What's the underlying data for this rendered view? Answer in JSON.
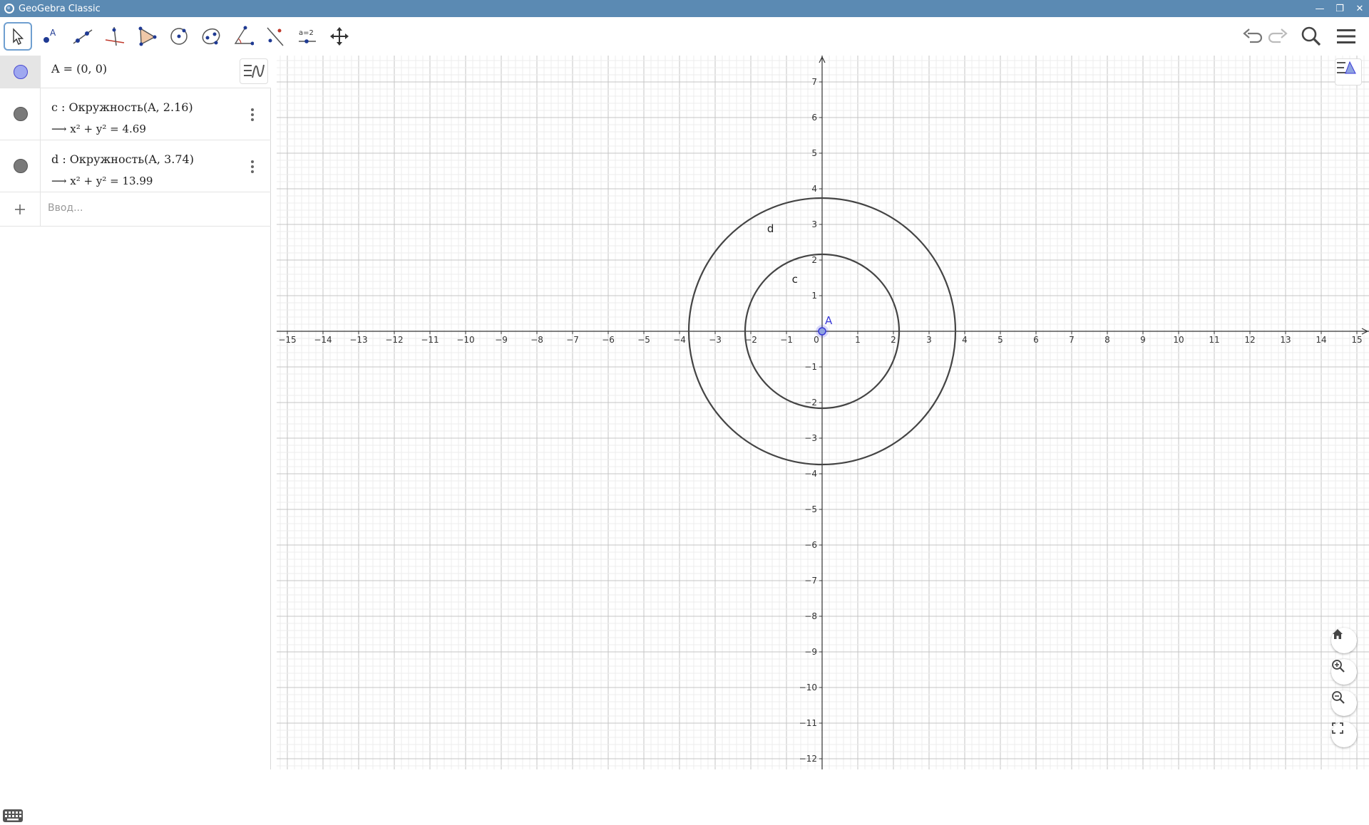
{
  "window": {
    "title": "GeoGebra Classic"
  },
  "toolbar": {
    "tools": [
      {
        "name": "move-tool",
        "icon": "arrow-cursor-icon",
        "active": true
      },
      {
        "name": "point-tool",
        "icon": "point-icon",
        "active": false
      },
      {
        "name": "line-tool",
        "icon": "line-icon",
        "active": false
      },
      {
        "name": "perpendicular-line-tool",
        "icon": "perpendicular-icon",
        "active": false
      },
      {
        "name": "polygon-tool",
        "icon": "polygon-icon",
        "active": false
      },
      {
        "name": "circle-center-point-tool",
        "icon": "circle-icon",
        "active": false
      },
      {
        "name": "ellipse-tool",
        "icon": "ellipse-icon",
        "active": false
      },
      {
        "name": "angle-tool",
        "icon": "angle-icon",
        "active": false
      },
      {
        "name": "reflect-tool",
        "icon": "reflect-icon",
        "active": false
      },
      {
        "name": "slider-tool",
        "icon": "slider-icon",
        "label": "a=2",
        "active": false
      },
      {
        "name": "move-graphics-view-tool",
        "icon": "move-view-icon",
        "active": false
      }
    ],
    "right": [
      "undo-icon",
      "redo-icon",
      "search-icon",
      "menu-icon"
    ]
  },
  "algebra": {
    "items": [
      {
        "name": "A",
        "definition": "A = (0, 0)",
        "marble_color": "#9fa8f0",
        "marble_border": "#4a4ad0",
        "selected": true
      },
      {
        "name": "c",
        "definition": "c : Окружность(A, 2.16)",
        "value": "x² + y² = 4.69",
        "marble_color": "#7a7a7a",
        "marble_border": "#555555"
      },
      {
        "name": "d",
        "definition": "d : Окружность(A, 3.74)",
        "value": "x² + y² = 13.99",
        "marble_color": "#7a7a7a",
        "marble_border": "#555555"
      }
    ],
    "input_placeholder": "Ввод...",
    "arrow": "⟶"
  },
  "graphics": {
    "x_range": [
      -15.5,
      15.5
    ],
    "y_range": [
      -12.4,
      7.8
    ],
    "x_ticks": [
      -15,
      -14,
      -13,
      -12,
      -11,
      -10,
      -9,
      -8,
      -7,
      -6,
      -5,
      -4,
      -3,
      -2,
      -1,
      0,
      1,
      2,
      3,
      4,
      5,
      6,
      7,
      8,
      9,
      10,
      11,
      12,
      13,
      14,
      15
    ],
    "y_ticks": [
      -12,
      -11,
      -10,
      -9,
      -8,
      -7,
      -6,
      -5,
      -4,
      -3,
      -2,
      -1,
      1,
      2,
      3,
      4,
      5,
      6,
      7
    ],
    "minus_sign": "−",
    "points": [
      {
        "label": "A",
        "x": 0,
        "y": 0,
        "color": "#3a3ad8"
      }
    ],
    "circles": [
      {
        "label": "c",
        "cx": 0,
        "cy": 0,
        "r": 2.16,
        "color": "#444444"
      },
      {
        "label": "d",
        "cx": 0,
        "cy": 0,
        "r": 3.74,
        "color": "#444444"
      }
    ],
    "grid": true
  }
}
